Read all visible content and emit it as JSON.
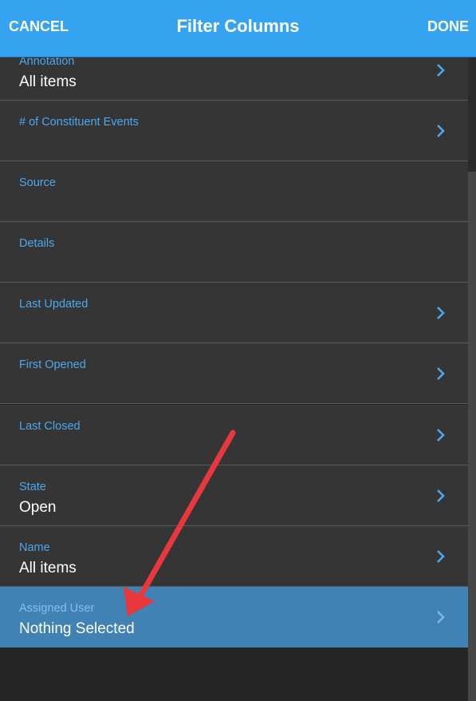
{
  "header": {
    "cancel_label": "CANCEL",
    "title": "Filter Columns",
    "done_label": "DONE"
  },
  "filters": [
    {
      "label": "Annotation",
      "value": "All items",
      "chevron": true
    },
    {
      "label": "# of Constituent Events",
      "value": "",
      "chevron": true
    },
    {
      "label": "Source",
      "value": "",
      "chevron": false
    },
    {
      "label": "Details",
      "value": "",
      "chevron": false
    },
    {
      "label": "Last Updated",
      "value": "",
      "chevron": true
    },
    {
      "label": "First Opened",
      "value": "",
      "chevron": true
    },
    {
      "label": "Last Closed",
      "value": "",
      "chevron": true
    },
    {
      "label": "State",
      "value": "Open",
      "chevron": true
    },
    {
      "label": "Name",
      "value": "All items",
      "chevron": true
    },
    {
      "label": "Assigned User",
      "value": "Nothing Selected",
      "chevron": true,
      "selected": true
    }
  ],
  "colors": {
    "header_bg": "#35a3f0",
    "row_bg": "#353535",
    "selected_row_bg": "#3f82b3",
    "label_color": "#4aa8f0",
    "annotation_arrow": "#e8383d"
  },
  "icons": {
    "row_chevron": "chevron-right-icon"
  }
}
